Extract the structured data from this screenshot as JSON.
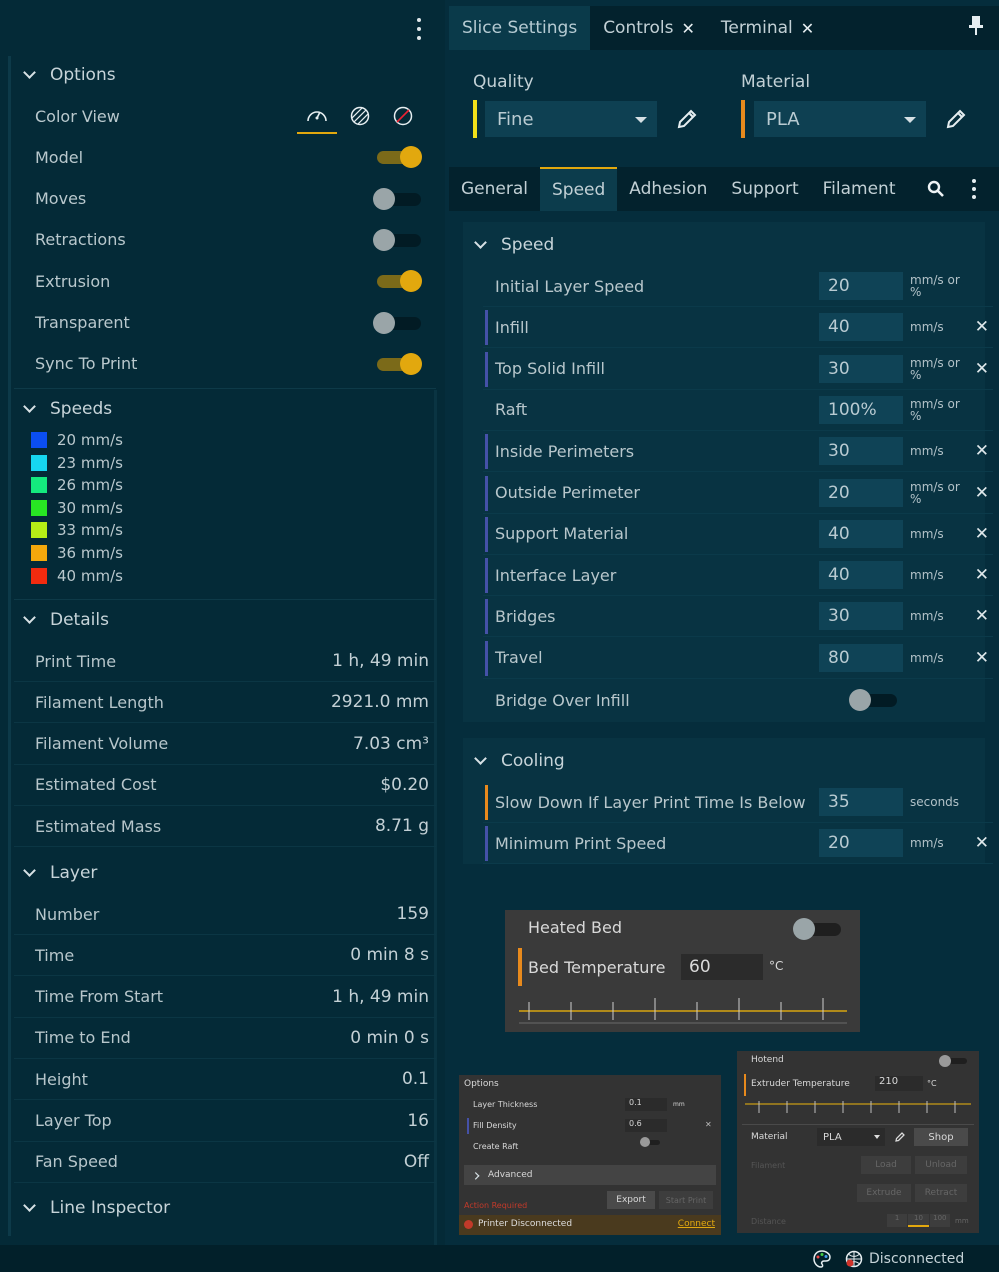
{
  "options": {
    "title": "Options",
    "rows": [
      {
        "label": "Color View"
      },
      {
        "label": "Model",
        "on": true
      },
      {
        "label": "Moves",
        "on": false
      },
      {
        "label": "Retractions",
        "on": false
      },
      {
        "label": "Extrusion",
        "on": true
      },
      {
        "label": "Transparent",
        "on": false
      },
      {
        "label": "Sync To Print",
        "on": true
      }
    ],
    "color_view_icons": [
      "speed-gauge-icon",
      "striped-circle-icon",
      "slashed-circle-icon"
    ]
  },
  "speeds": {
    "title": "Speeds",
    "items": [
      {
        "label": "20 mm/s",
        "color": "#0b4ef2"
      },
      {
        "label": "23 mm/s",
        "color": "#16d6f0"
      },
      {
        "label": "26 mm/s",
        "color": "#14ea7e"
      },
      {
        "label": "30 mm/s",
        "color": "#28e623"
      },
      {
        "label": "33 mm/s",
        "color": "#b6ee16"
      },
      {
        "label": "36 mm/s",
        "color": "#f4a80c"
      },
      {
        "label": "40 mm/s",
        "color": "#f22b0f"
      }
    ]
  },
  "details": {
    "title": "Details",
    "rows": [
      {
        "label": "Print Time",
        "value": "1 h, 49 min"
      },
      {
        "label": "Filament Length",
        "value": "2921.0 mm"
      },
      {
        "label": "Filament Volume",
        "value": "7.03 cm³"
      },
      {
        "label": "Estimated Cost",
        "value": "$0.20"
      },
      {
        "label": "Estimated Mass",
        "value": "8.71 g"
      }
    ]
  },
  "layer": {
    "title": "Layer",
    "rows": [
      {
        "label": "Number",
        "value": "159"
      },
      {
        "label": "Time",
        "value": "0 min 8 s"
      },
      {
        "label": "Time From Start",
        "value": "1 h, 49 min"
      },
      {
        "label": "Time to End",
        "value": "0 min 0 s"
      },
      {
        "label": "Height",
        "value": "0.1"
      },
      {
        "label": "Layer Top",
        "value": "16"
      },
      {
        "label": "Fan Speed",
        "value": "Off"
      }
    ]
  },
  "line_inspector": {
    "title": "Line Inspector"
  },
  "tabs": [
    {
      "label": "Slice Settings",
      "active": true,
      "closable": false
    },
    {
      "label": "Controls",
      "active": false,
      "closable": true
    },
    {
      "label": "Terminal",
      "active": false,
      "closable": true
    }
  ],
  "quality": {
    "label": "Quality",
    "value": "Fine",
    "color": "#f2e01a"
  },
  "material": {
    "label": "Material",
    "value": "PLA",
    "color": "#e88a1d"
  },
  "subtabs": [
    {
      "label": "General",
      "active": false
    },
    {
      "label": "Speed",
      "active": true
    },
    {
      "label": "Adhesion",
      "active": false
    },
    {
      "label": "Support",
      "active": false
    },
    {
      "label": "Filament",
      "active": false
    }
  ],
  "speed_section": {
    "title": "Speed",
    "rows": [
      {
        "label": "Initial Layer Speed",
        "value": "20",
        "unit": "mm/s or %",
        "mark": "none",
        "clearable": false
      },
      {
        "label": "Infill",
        "value": "40",
        "unit": "mm/s",
        "mark": "blue",
        "clearable": true
      },
      {
        "label": "Top Solid Infill",
        "value": "30",
        "unit": "mm/s or %",
        "mark": "blue",
        "clearable": true
      },
      {
        "label": "Raft",
        "value": "100%",
        "unit": "mm/s or %",
        "mark": "none",
        "clearable": false
      },
      {
        "label": "Inside Perimeters",
        "value": "30",
        "unit": "mm/s",
        "mark": "blue",
        "clearable": true
      },
      {
        "label": "Outside Perimeter",
        "value": "20",
        "unit": "mm/s or %",
        "mark": "blue",
        "clearable": true
      },
      {
        "label": "Support Material",
        "value": "40",
        "unit": "mm/s",
        "mark": "blue",
        "clearable": true
      },
      {
        "label": "Interface Layer",
        "value": "40",
        "unit": "mm/s",
        "mark": "blue",
        "clearable": true
      },
      {
        "label": "Bridges",
        "value": "30",
        "unit": "mm/s",
        "mark": "blue",
        "clearable": true
      },
      {
        "label": "Travel",
        "value": "80",
        "unit": "mm/s",
        "mark": "blue",
        "clearable": true
      }
    ],
    "bridge_over_infill": {
      "label": "Bridge Over Infill",
      "on": false
    }
  },
  "cooling_section": {
    "title": "Cooling",
    "rows": [
      {
        "label": "Slow Down If Layer Print Time Is Below",
        "value": "35",
        "unit": "seconds",
        "mark": "orange",
        "clearable": false
      },
      {
        "label": "Minimum Print Speed",
        "value": "20",
        "unit": "mm/s",
        "mark": "blue",
        "clearable": true
      }
    ]
  },
  "heated_bed": {
    "title": "Heated Bed",
    "on": false,
    "temp_label": "Bed Temperature",
    "temp_value": "60",
    "temp_unit": "°C"
  },
  "options_thumb": {
    "title": "Options",
    "rows": [
      {
        "label": "Layer Thickness",
        "value": "0.1",
        "unit": "mm"
      },
      {
        "label": "Fill Density",
        "value": "0.6",
        "unit": ""
      },
      {
        "label": "Create Raft",
        "value": "",
        "unit": ""
      }
    ],
    "advanced": "Advanced",
    "export": "Export",
    "start_print": "Start Print",
    "action_required": "Action Required",
    "printer_status": "Printer Disconnected",
    "connect": "Connect"
  },
  "hotend_thumb": {
    "title": "Hotend",
    "temp_label": "Extruder Temperature",
    "temp_value": "210",
    "temp_unit": "°C",
    "material_label": "Material",
    "material_value": "PLA",
    "shop": "Shop",
    "filament_label": "Filament",
    "load": "Load",
    "unload": "Unload",
    "extrude": "Extrude",
    "retract": "Retract",
    "distance_label": "Distance",
    "distance_options": [
      "1",
      "10",
      "100"
    ],
    "distance_unit": "mm"
  },
  "status": {
    "text": "Disconnected"
  }
}
